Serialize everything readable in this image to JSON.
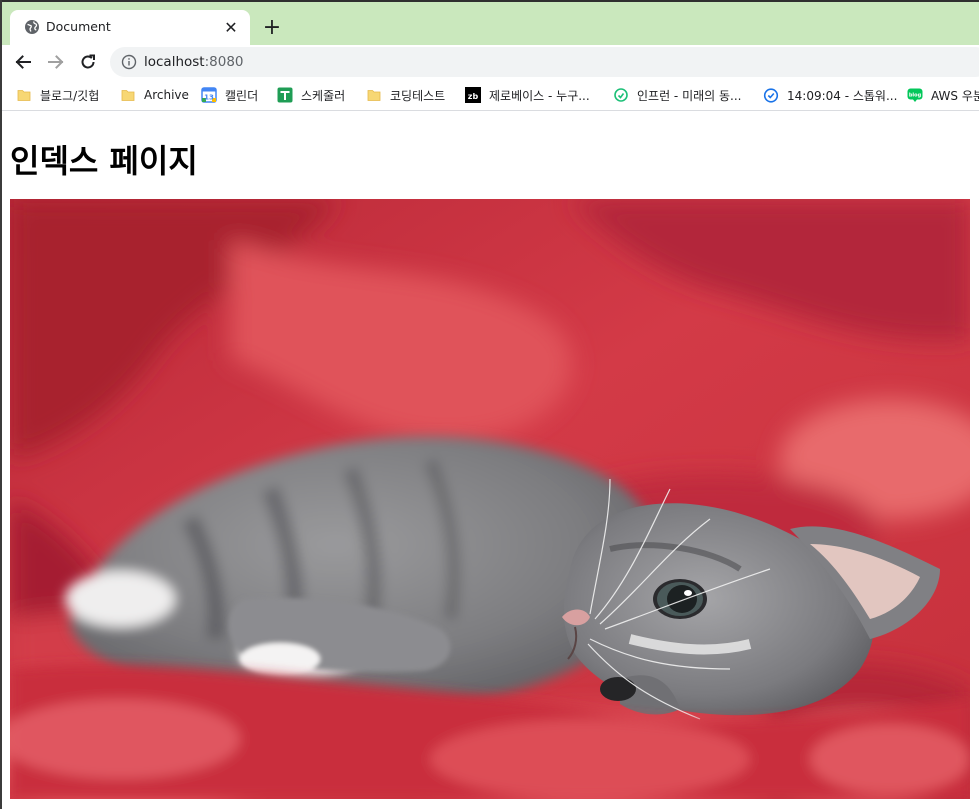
{
  "tab": {
    "title": "Document"
  },
  "address_bar": {
    "host": "localhost",
    "port": ":8080"
  },
  "bookmarks": [
    {
      "label": "블로그/깃헙",
      "icon": "folder-icon"
    },
    {
      "label": "Archive",
      "icon": "folder-icon"
    },
    {
      "label": "캘린더",
      "icon": "calendar-icon"
    },
    {
      "label": "스케줄러",
      "icon": "scheduler-icon"
    },
    {
      "label": "코딩테스트",
      "icon": "folder-icon"
    },
    {
      "label": "제로베이스 - 누구...",
      "icon": "zb-icon"
    },
    {
      "label": "인프런 - 미래의 동...",
      "icon": "inflearn-icon"
    },
    {
      "label": "14:09:04 - 스톱워...",
      "icon": "stopwatch-icon"
    },
    {
      "label": "AWS 우분",
      "icon": "blog-icon"
    }
  ],
  "page": {
    "heading": "인덱스 페이지",
    "image_subject": "kitten-photo"
  },
  "colors": {
    "tabstrip_bg": "#cae8bd",
    "omnibox_bg": "#f1f3f4",
    "folder": "#f7d774",
    "photo_red": "#c8303e"
  }
}
